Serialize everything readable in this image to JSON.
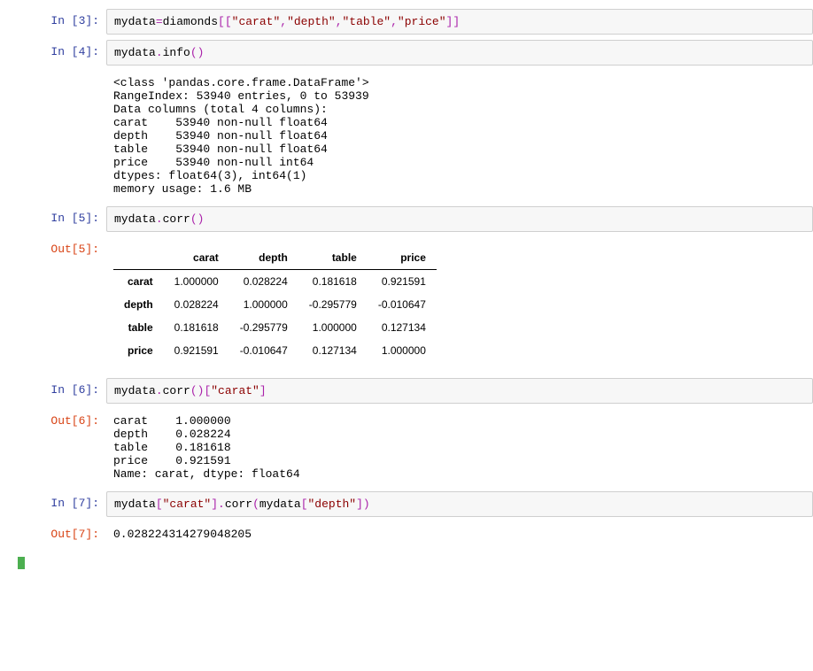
{
  "prompts": {
    "in3": "In  [3]:",
    "in4": "In  [4]:",
    "in5": "In  [5]:",
    "out5": "Out[5]:",
    "in6": "In  [6]:",
    "out6": "Out[6]:",
    "in7": "In  [7]:",
    "out7": "Out[7]:"
  },
  "code3": {
    "p0": "mydata",
    "p1": "=",
    "p2": "diamonds",
    "p3": "[[",
    "s0": "\"carat\"",
    "c": ",",
    "s1": "\"depth\"",
    "s2": "\"table\"",
    "s3": "\"price\"",
    "p4": "]]"
  },
  "code4": {
    "p0": "mydata",
    "p1": ".",
    "p2": "info",
    "p3": "()"
  },
  "out4_lines": [
    "<class 'pandas.core.frame.DataFrame'>",
    "RangeIndex: 53940 entries, 0 to 53939",
    "Data columns (total 4 columns):",
    "carat    53940 non-null float64",
    "depth    53940 non-null float64",
    "table    53940 non-null float64",
    "price    53940 non-null int64",
    "dtypes: float64(3), int64(1)",
    "memory usage: 1.6 MB"
  ],
  "code5": {
    "p0": "mydata",
    "p1": ".",
    "p2": "corr",
    "p3": "()"
  },
  "table5": {
    "cols": [
      "carat",
      "depth",
      "table",
      "price"
    ],
    "rows": [
      {
        "h": "carat",
        "v": [
          "1.000000",
          "0.028224",
          "0.181618",
          "0.921591"
        ]
      },
      {
        "h": "depth",
        "v": [
          "0.028224",
          "1.000000",
          "-0.295779",
          "-0.010647"
        ]
      },
      {
        "h": "table",
        "v": [
          "0.181618",
          "-0.295779",
          "1.000000",
          "0.127134"
        ]
      },
      {
        "h": "price",
        "v": [
          "0.921591",
          "-0.010647",
          "0.127134",
          "1.000000"
        ]
      }
    ]
  },
  "code6": {
    "p0": "mydata",
    "p1": ".",
    "p2": "corr",
    "p3": "()[",
    "s0": "\"carat\"",
    "p4": "]"
  },
  "out6_lines": [
    "carat    1.000000",
    "depth    0.028224",
    "table    0.181618",
    "price    0.921591",
    "Name: carat, dtype: float64"
  ],
  "code7": {
    "p0": "mydata",
    "p1": "[",
    "s0": "\"carat\"",
    "p2": "].",
    "p3": "corr",
    "p4": "(",
    "p5": "mydata",
    "p6": "[",
    "s1": "\"depth\"",
    "p7": "])"
  },
  "out7": "0.028224314279048205"
}
